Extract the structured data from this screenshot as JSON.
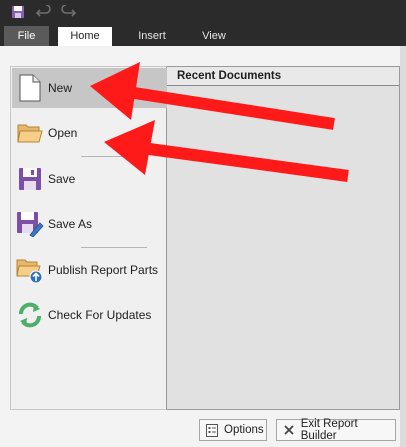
{
  "ribbon": {
    "tabs": [
      {
        "label": "File"
      },
      {
        "label": "Home"
      },
      {
        "label": "Insert"
      },
      {
        "label": "View"
      }
    ]
  },
  "quick_access": {
    "icons": [
      "save-icon",
      "undo-icon",
      "redo-icon"
    ]
  },
  "backstage": {
    "nav": [
      {
        "label": "New",
        "icon": "new-document-icon",
        "selected": true
      },
      {
        "label": "Open",
        "icon": "open-folder-icon"
      },
      {
        "label": "Save",
        "icon": "save-icon"
      },
      {
        "label": "Save As",
        "icon": "save-as-icon"
      },
      {
        "label": "Publish Report Parts",
        "icon": "publish-icon"
      },
      {
        "label": "Check For Updates",
        "icon": "refresh-icon"
      }
    ],
    "recent_title": "Recent Documents",
    "buttons": {
      "options": "Options",
      "exit": "Exit Report Builder"
    }
  },
  "colors": {
    "title_bar": "#2b2b2b",
    "selected_item": "#c6c6c6",
    "annotation_arrow": "#ff1a1a"
  }
}
